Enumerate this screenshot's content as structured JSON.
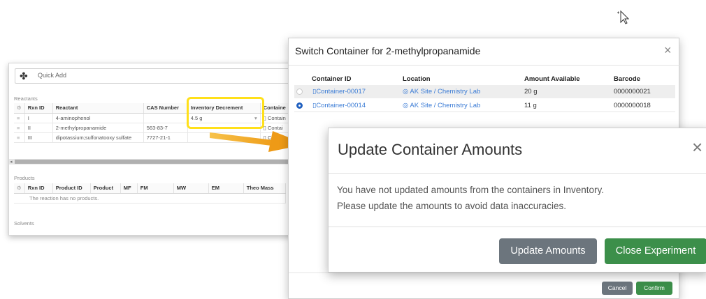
{
  "background_panel": {
    "quick_add_placeholder": "Quick Add",
    "icons": {
      "quick_add": "molecule-icon",
      "settings": "gear-icon",
      "row_handle": "drag-handle-icon",
      "container": "container-icon"
    },
    "reactants": {
      "label": "Reactants",
      "columns": [
        "Rxn ID",
        "Reactant",
        "CAS Number",
        "Inventory Decrement",
        "Containe"
      ],
      "rows": [
        {
          "rxn_id": "I",
          "reactant": "4-aminophenol",
          "cas": "",
          "inventory_decrement": "4.5 g",
          "container": "Contain"
        },
        {
          "rxn_id": "II",
          "reactant": "2-methylpropanamide",
          "cas": "563-83-7",
          "inventory_decrement": "",
          "container": "Contai"
        },
        {
          "rxn_id": "III",
          "reactant": "dipotassium;sulfonatooxy sulfate",
          "cas": "7727-21-1",
          "inventory_decrement": "",
          "container": "Conta"
        }
      ]
    },
    "products": {
      "label": "Products",
      "columns": [
        "Rxn ID",
        "Product ID",
        "Product",
        "MF",
        "FM",
        "MW",
        "EM",
        "Theo Mass"
      ],
      "empty_text": "The reaction has no products."
    },
    "solvents": {
      "label": "Solvents"
    }
  },
  "switch_modal": {
    "title": "Switch Container for 2-methylpropanamide",
    "close_glyph": "×",
    "columns": [
      "Container ID",
      "Location",
      "Amount Available",
      "Barcode"
    ],
    "rows": [
      {
        "container_id": "Container-00017",
        "location": "AK Site / Chemistry Lab",
        "amount": "20 g",
        "barcode": "0000000021",
        "selected": false
      },
      {
        "container_id": "Container-00014",
        "location": "AK Site / Chemistry Lab",
        "amount": "11 g",
        "barcode": "0000000018",
        "selected": true
      }
    ],
    "cancel_label": "Cancel",
    "confirm_label": "Confirm"
  },
  "update_modal": {
    "title": "Update Container Amounts",
    "close_glyph": "×",
    "message_line1": "You have not updated amounts from the containers in Inventory.",
    "message_line2": "Please update the amounts to avoid data inaccuracies.",
    "update_label": "Update Amounts",
    "close_label": "Close Experiment"
  },
  "colors": {
    "link": "#3a7bd5",
    "highlight": "#ffe01a",
    "arrow": "#f0a21e",
    "update_button": "#6c757d",
    "close_button": "#3c8f4a",
    "cancel_button": "#6c757d",
    "confirm_button": "#3c8f4a"
  }
}
